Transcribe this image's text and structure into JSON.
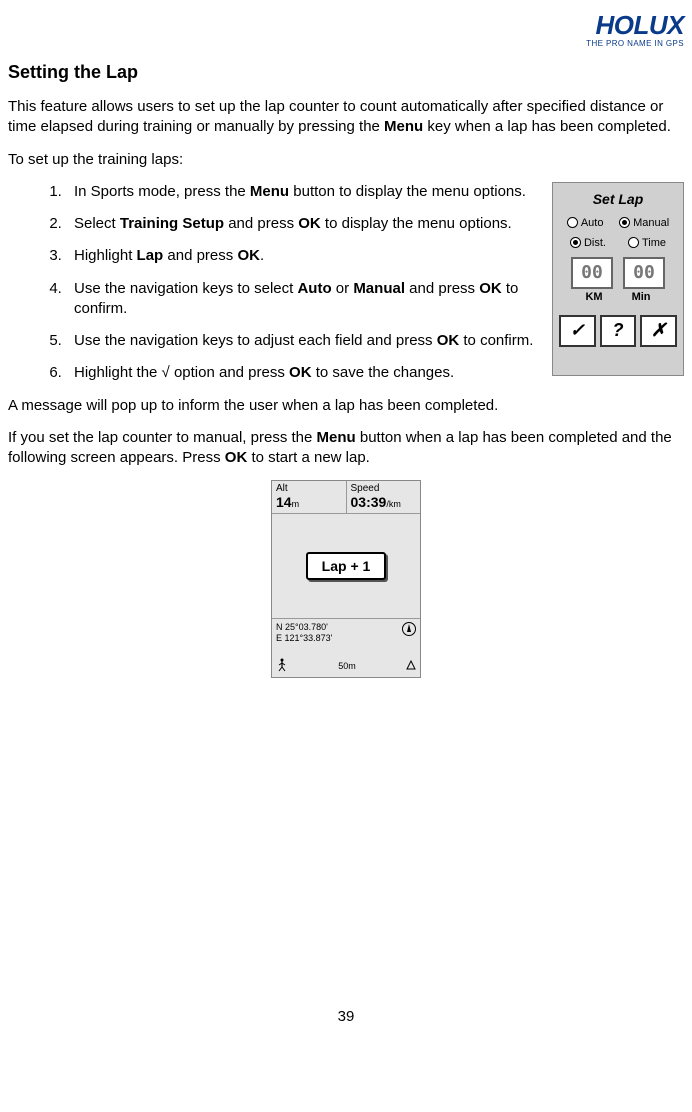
{
  "logo": {
    "main": "HOLUX",
    "sub": "THE PRO NAME IN GPS"
  },
  "title": "Setting the Lap",
  "intro_a": "This feature allows users to set up the lap counter to count automatically after specified distance or time elapsed during training or manually by pressing the ",
  "intro_b": "Menu",
  "intro_c": " key when a lap has been completed.",
  "toset": "To set up the training laps:",
  "steps": {
    "s1a": "In Sports mode, press the ",
    "s1b": "Menu",
    "s1c": " button to display the menu options.",
    "s2a": "Select ",
    "s2b": "Training Setup",
    "s2c": " and press ",
    "s2d": "OK",
    "s2e": " to display the menu options.",
    "s3a": "Highlight ",
    "s3b": "Lap",
    "s3c": " and press ",
    "s3d": "OK",
    "s3e": ".",
    "s4a": "Use the navigation keys to select ",
    "s4b": "Auto",
    "s4c": " or ",
    "s4d": "Manual",
    "s4e": " and press ",
    "s4f": "OK",
    "s4g": " to confirm.",
    "s5a": "Use the navigation keys to adjust each field and press ",
    "s5b": "OK",
    "s5c": " to confirm.",
    "s6a": "Highlight the √ option and press ",
    "s6b": "OK",
    "s6c": " to save the changes."
  },
  "after1": "A message will pop up to inform the user when a lap has been completed.",
  "after2a": "If you set the lap counter to manual, press the ",
  "after2b": "Menu",
  "after2c": " button when a lap has been completed and the following screen appears. Press ",
  "after2d": "OK",
  "after2e": " to start a new lap.",
  "setlap": {
    "title": "Set Lap",
    "auto": "Auto",
    "manual": "Manual",
    "dist": "Dist.",
    "time": "Time",
    "num1": "00",
    "num2": "00",
    "unit1": "KM",
    "unit2": "Min",
    "ok": "✓",
    "help": "?",
    "cancel": "✗"
  },
  "lapscreen": {
    "alt_label": "Alt",
    "alt_val": "14",
    "alt_unit": "m",
    "speed_label": "Speed",
    "speed_val": "03:39",
    "speed_unit": "/km",
    "button": "Lap + 1",
    "coord1": "N 25°03.780'",
    "coord2": "E 121°33.873'",
    "scale": "50m"
  },
  "page": "39"
}
